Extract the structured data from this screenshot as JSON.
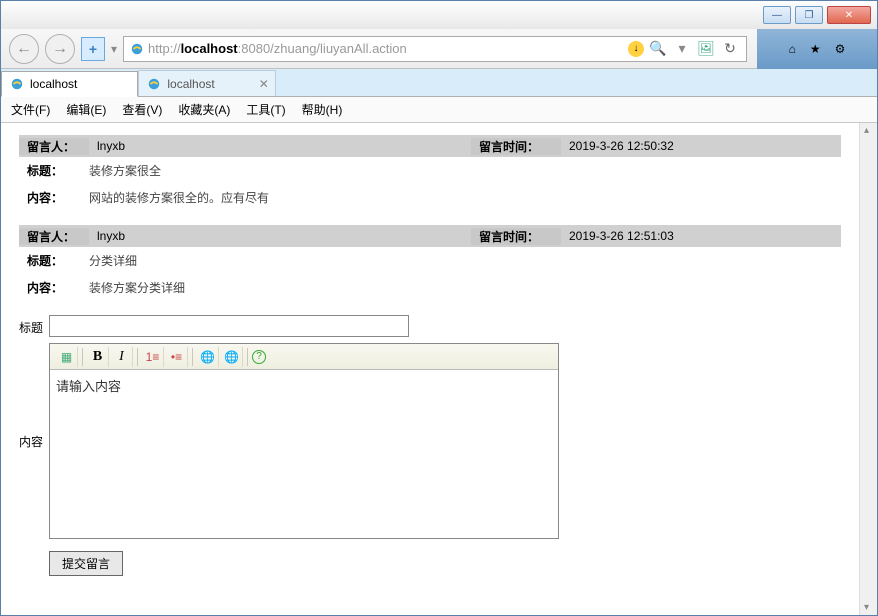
{
  "window": {
    "min_btn": "—",
    "max_btn": "❐",
    "close_btn": "✕"
  },
  "nav": {
    "back": "←",
    "forward": "→",
    "shield": "+",
    "url_prefix": "http://",
    "url_host": "localhost",
    "url_rest": ":8080/zhuang/liuyanAll.action",
    "search_glyph": "🔍",
    "dropdown": "▾",
    "refresh": "↻",
    "home": "⌂",
    "star": "★",
    "gear": "⚙"
  },
  "tabs": [
    {
      "label": "localhost",
      "active": true
    },
    {
      "label": "localhost",
      "active": false
    }
  ],
  "menu": {
    "file": "文件(F)",
    "edit": "编辑(E)",
    "view": "查看(V)",
    "favorites": "收藏夹(A)",
    "tools": "工具(T)",
    "help": "帮助(H)"
  },
  "labels": {
    "author": "留言人：",
    "time": "留言时间：",
    "title": "标题：",
    "content": "内容：",
    "form_title": "标题",
    "form_content": "内容",
    "submit": "提交留言",
    "editor_placeholder": "请输入内容"
  },
  "messages": [
    {
      "author": "lnyxb",
      "time": "2019-3-26 12:50:32",
      "title": "装修方案很全",
      "content": "网站的装修方案很全的。应有尽有"
    },
    {
      "author": "lnyxb",
      "time": "2019-3-26 12:51:03",
      "title": "分类详细",
      "content": "装修方案分类详细"
    }
  ],
  "editor_icons": {
    "source": "▦",
    "bold": "B",
    "italic": "I",
    "ol": "≡",
    "ul": "⋮≡",
    "link": "🔗",
    "unlink": "✂",
    "help": "?"
  }
}
